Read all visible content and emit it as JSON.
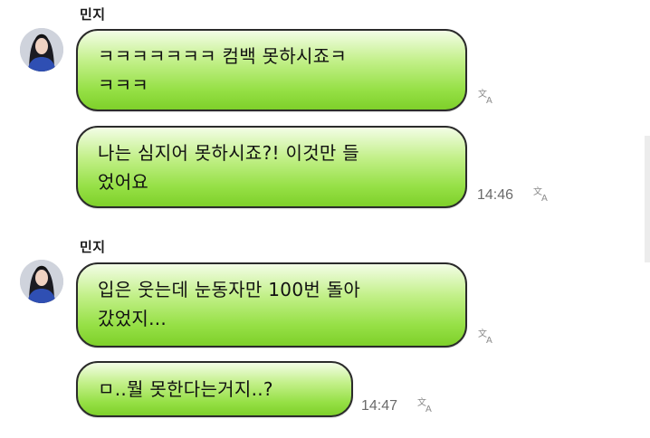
{
  "messages": [
    {
      "sender": "민지",
      "bubbles": [
        {
          "text": "ㅋㅋㅋㅋㅋㅋㅋ 컴백 못하시죠ㅋ\nㅋㅋㅋ",
          "time": ""
        },
        {
          "text": "나는 심지어 못하시죠?! 이것만 들\n었어요",
          "time": "14:46"
        }
      ]
    },
    {
      "sender": "민지",
      "bubbles": [
        {
          "text": "입은 웃는데 눈동자만 100번 돌아\n갔었지...",
          "time": ""
        },
        {
          "text": "ㅁ..뭘 못한다는거지..?",
          "time": "14:47"
        }
      ]
    }
  ],
  "icons": {
    "avatar": "profile-photo",
    "translate": "translate-icon"
  }
}
